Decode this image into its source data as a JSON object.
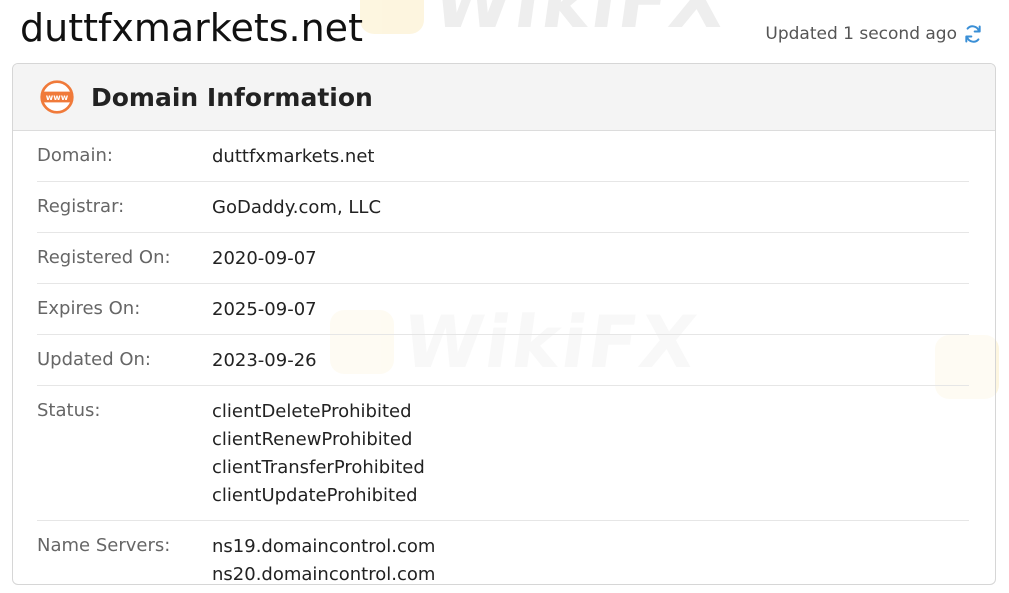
{
  "header": {
    "site_title": "duttfxmarkets.net",
    "updated_text": "Updated 1 second ago"
  },
  "card": {
    "title": "Domain Information",
    "icon": "www-icon",
    "rows": [
      {
        "label": "Domain:",
        "values": [
          "duttfxmarkets.net"
        ]
      },
      {
        "label": "Registrar:",
        "values": [
          "GoDaddy.com, LLC"
        ]
      },
      {
        "label": "Registered On:",
        "values": [
          "2020-09-07"
        ]
      },
      {
        "label": "Expires On:",
        "values": [
          "2025-09-07"
        ]
      },
      {
        "label": "Updated On:",
        "values": [
          "2023-09-26"
        ]
      },
      {
        "label": "Status:",
        "values": [
          "clientDeleteProhibited",
          "clientRenewProhibited",
          "clientTransferProhibited",
          "clientUpdateProhibited"
        ]
      },
      {
        "label": "Name Servers:",
        "values": [
          "ns19.domaincontrol.com",
          "ns20.domaincontrol.com"
        ]
      }
    ]
  },
  "colors": {
    "accent": "#f07a3a",
    "refresh": "#3a8fd6"
  },
  "watermark": "WikiFX"
}
